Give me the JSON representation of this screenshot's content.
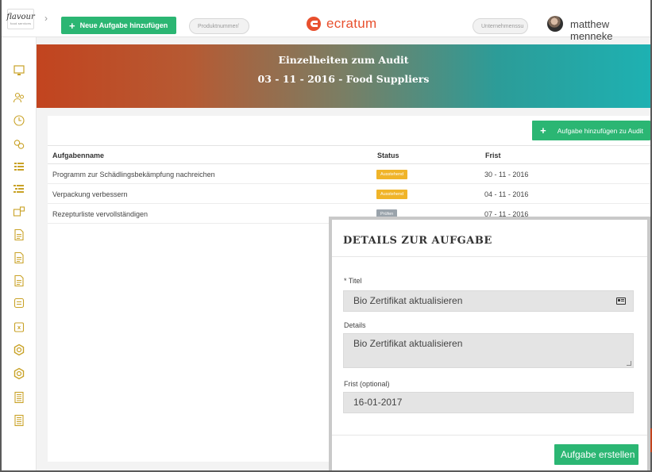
{
  "header": {
    "logo_text": "flavour",
    "logo_sub": "food services",
    "new_task_label": "Neue Aufgabe hinzufügen",
    "product_placeholder": "Produktnummer/",
    "brand_name": "ecratum",
    "company_placeholder": "Unternehmenssu",
    "user_name": "matthew menneke"
  },
  "colors": {
    "accent_green": "#2bb673",
    "brand_orange": "#e8502e",
    "badge_pending": "#f0b429",
    "badge_check": "#9aa3ab"
  },
  "sidebar": {
    "icons": [
      "monitor-icon",
      "users-icon",
      "clock-document-icon",
      "link-icon",
      "list-icon",
      "list-tree-icon",
      "transfer-icon",
      "document-icon",
      "document-icon",
      "document-icon",
      "printer-icon",
      "calendar-icon",
      "gear-icon",
      "gear-icon",
      "report-icon",
      "report-icon"
    ]
  },
  "hero": {
    "title": "Einzelheiten zum Audit",
    "subtitle": "03 - 11 - 2016 - Food Suppliers"
  },
  "table": {
    "add_button_label": "Aufgabe hinzufügen zu Audit",
    "columns": [
      "Aufgabenname",
      "Status",
      "Frist"
    ],
    "rows": [
      {
        "name": "Programm zur Schädlingsbekämpfung nachreichen",
        "status": "Ausstehend",
        "status_color": "#f0b429",
        "due": "30 - 11 - 2016"
      },
      {
        "name": "Verpackung verbessern",
        "status": "Ausstehend",
        "status_color": "#f0b429",
        "due": "04 - 11 - 2016"
      },
      {
        "name": "Rezepturliste vervollständigen",
        "status": "Prüfen",
        "status_color": "#9aa3ab",
        "due": "07 - 11 - 2016"
      }
    ]
  },
  "modal": {
    "title": "DETAILS ZUR AUFGABE",
    "title_label": "* Titel",
    "title_value": "Bio Zertifikat aktualisieren",
    "details_label": "Details",
    "details_value": "Bio Zertifikat aktualisieren",
    "due_label": "Frist (optional)",
    "due_value": "16-01-2017",
    "create_button_label": "Aufgabe erstellen"
  }
}
